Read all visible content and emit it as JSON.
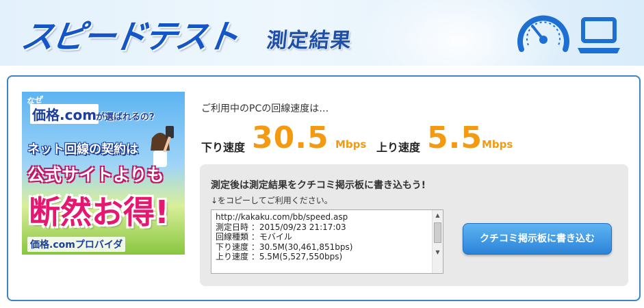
{
  "header": {
    "title_main": "スピードテスト",
    "title_sub": "測定結果",
    "icons": [
      "speedometer-icon",
      "laptop-icon"
    ]
  },
  "ad": {
    "naze": "なぜ",
    "kakaku": "価格.com",
    "erabareru": "が選ばれるの?",
    "net": "ネット回線の契約は",
    "koushiki": "公式サイトよりも",
    "danzen": "断然お得!",
    "provider": "価格.comプロバイダ"
  },
  "result": {
    "intro": "ご利用中のPCの回線速度は…",
    "down_label": "下り速度",
    "down_value": "30.5",
    "down_unit": "Mbps",
    "up_label": "上り速度",
    "up_value": "5.5",
    "up_unit": "Mbps"
  },
  "copy": {
    "title": "測定後は測定結果をクチコミ掲示板に書き込もう!",
    "subtitle": "↓をコピーしてご利用ください。",
    "lines": [
      "http://kakaku.com/bb/speed.asp",
      "測定日時 ：2015/09/23 21:17:03",
      "回線種類 ：モバイル",
      "下り速度 ：30.5M(30,461,851bps)",
      "上り速度 ：5.5M(5,527,550bps)"
    ],
    "button": "クチコミ掲示板に書き込む"
  },
  "colors": {
    "accent_blue": "#1455c8",
    "speed_orange": "#f39a10",
    "panel_border": "#3b82cc",
    "button_blue": "#2b83d9"
  }
}
